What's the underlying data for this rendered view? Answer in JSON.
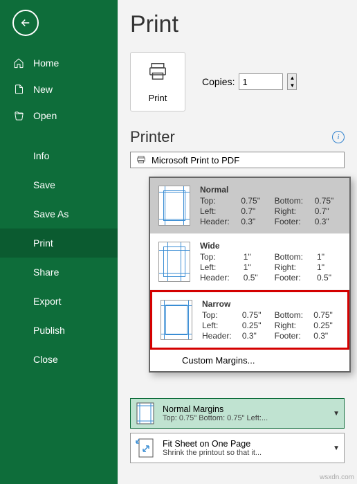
{
  "sidebar": {
    "main": [
      {
        "label": "Home"
      },
      {
        "label": "New"
      },
      {
        "label": "Open"
      }
    ],
    "secondary": [
      {
        "label": "Info"
      },
      {
        "label": "Save"
      },
      {
        "label": "Save As"
      },
      {
        "label": "Print"
      },
      {
        "label": "Share"
      },
      {
        "label": "Export"
      },
      {
        "label": "Publish"
      },
      {
        "label": "Close"
      }
    ]
  },
  "title": "Print",
  "print_button": "Print",
  "copies": {
    "label": "Copies:",
    "value": "1"
  },
  "printer": {
    "heading": "Printer",
    "selected": "Microsoft Print to PDF"
  },
  "margins": {
    "options": [
      {
        "label": "Normal",
        "top_k": "Top:",
        "top_v": "0.75\"",
        "bottom_k": "Bottom:",
        "bottom_v": "0.75\"",
        "left_k": "Left:",
        "left_v": "0.7\"",
        "right_k": "Right:",
        "right_v": "0.7\"",
        "header_k": "Header:",
        "header_v": "0.3\"",
        "footer_k": "Footer:",
        "footer_v": "0.3\""
      },
      {
        "label": "Wide",
        "top_k": "Top:",
        "top_v": "1\"",
        "bottom_k": "Bottom:",
        "bottom_v": "1\"",
        "left_k": "Left:",
        "left_v": "1\"",
        "right_k": "Right:",
        "right_v": "1\"",
        "header_k": "Header:",
        "header_v": "0.5\"",
        "footer_k": "Footer:",
        "footer_v": "0.5\""
      },
      {
        "label": "Narrow",
        "top_k": "Top:",
        "top_v": "0.75\"",
        "bottom_k": "Bottom:",
        "bottom_v": "0.75\"",
        "left_k": "Left:",
        "left_v": "0.25\"",
        "right_k": "Right:",
        "right_v": "0.25\"",
        "header_k": "Header:",
        "header_v": "0.3\"",
        "footer_k": "Footer:",
        "footer_v": "0.3\""
      }
    ],
    "custom": "Custom Margins..."
  },
  "settings": {
    "normal_margins": {
      "title": "Normal Margins",
      "sub": "Top: 0.75\" Bottom: 0.75\" Left:..."
    },
    "fit": {
      "title": "Fit Sheet on One Page",
      "sub": "Shrink the printout so that it..."
    }
  },
  "watermark": "wsxdn.com"
}
